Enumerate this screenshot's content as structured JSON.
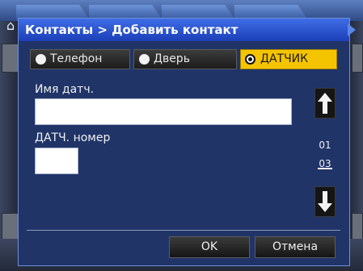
{
  "dialog": {
    "title": "Контакты > Добавить контакт"
  },
  "contact_types": [
    {
      "label": "Телефон",
      "selected": false
    },
    {
      "label": "Дверь",
      "selected": false
    },
    {
      "label": "ДАТЧИК",
      "selected": true
    }
  ],
  "form": {
    "sensor_name_label": "Имя датч.",
    "sensor_name_value": "",
    "sensor_number_label": "ДАТЧ. номер",
    "sensor_number_value": ""
  },
  "pagination": {
    "current_page": "01",
    "total_pages": "03"
  },
  "buttons": {
    "ok": "OK",
    "cancel": "Отмена"
  },
  "colors": {
    "dialog_bg": "#203468",
    "titlebar": "#2f56d6",
    "selected_radio": "#f5c400"
  },
  "icons": {
    "home": "home-icon",
    "scroll_up": "arrow-up-icon",
    "scroll_down": "arrow-down-icon"
  }
}
